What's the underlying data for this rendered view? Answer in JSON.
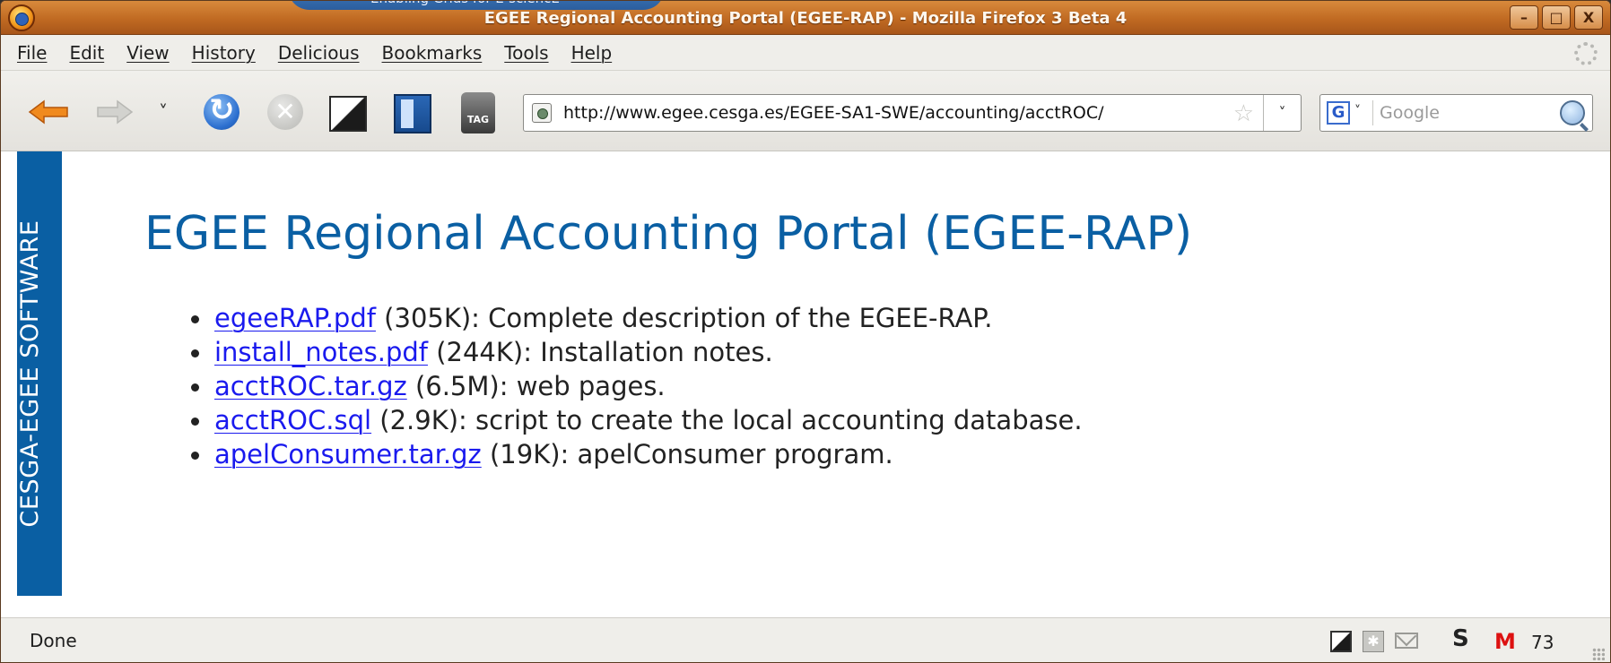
{
  "window": {
    "overlay_tooltip": "Enabling Grids for E-sciencE",
    "title": "EGEE Regional Accounting Portal (EGEE-RAP) - Mozilla Firefox 3 Beta 4",
    "controls": {
      "minimize": "–",
      "maximize": "□",
      "close": "X"
    }
  },
  "menu": {
    "items": [
      "File",
      "Edit",
      "View",
      "History",
      "Delicious",
      "Bookmarks",
      "Tools",
      "Help"
    ]
  },
  "toolbar": {
    "history_chevron": "˅",
    "url": "http://www.egee.cesga.es/EGEE-SA1-SWE/accounting/acctROC/",
    "tag_label": "TAG",
    "url_dropdown": "˅"
  },
  "search": {
    "engine_letter": "G",
    "engine_chevron": "˅",
    "placeholder": "Google"
  },
  "sidebar": {
    "banner_text": "CESGA-EGEE SOFTWARE"
  },
  "page": {
    "title": "EGEE Regional Accounting Portal (EGEE-RAP)",
    "files": [
      {
        "link": "egeeRAP.pdf",
        "desc": " (305K): Complete description of the EGEE-RAP."
      },
      {
        "link": "install_notes.pdf",
        "desc": " (244K): Installation notes."
      },
      {
        "link": "acctROC.tar.gz",
        "desc": " (6.5M): web pages."
      },
      {
        "link": "acctROC.sql",
        "desc": " (2.9K): script to create the local accounting database."
      },
      {
        "link": "apelConsumer.tar.gz",
        "desc": " (19K): apelConsumer program."
      }
    ]
  },
  "status": {
    "text": "Done",
    "mail_count": "73",
    "s_icon": "S",
    "gmail_icon": "M"
  },
  "colors": {
    "titlebar": "#c06a22",
    "banner": "#0a5fa3",
    "link": "#1a1aee"
  }
}
